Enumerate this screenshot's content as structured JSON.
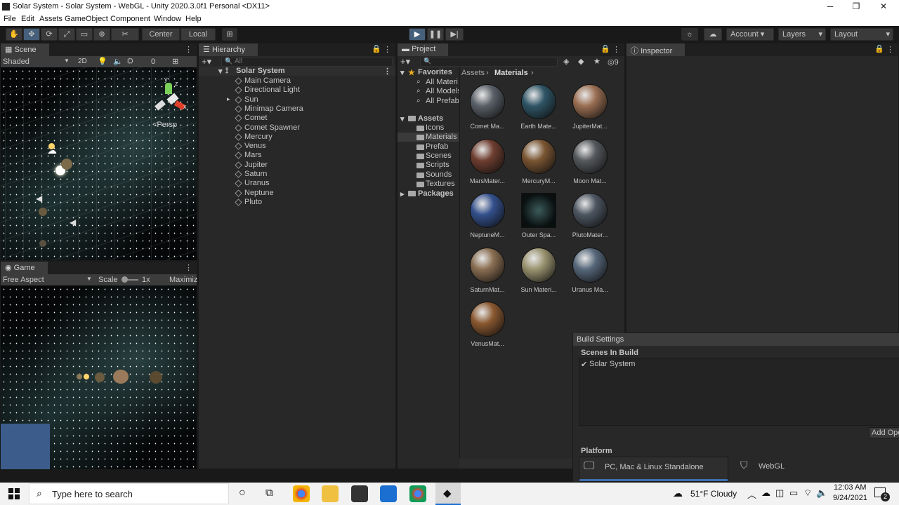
{
  "window": {
    "title": "Solar System - Solar System - WebGL - Unity 2020.3.0f1 Personal <DX11>",
    "minimize": "─",
    "maximize": "❐",
    "close": "✕"
  },
  "menu": [
    "File",
    "Edit",
    "Assets",
    "GameObject",
    "Component",
    "Window",
    "Help"
  ],
  "toolbar": {
    "center_label": "Center",
    "local_label": "Local",
    "account": "Account",
    "layers": "Layers",
    "layout": "Layout",
    "play_icon": "play-icon",
    "pause_icon": "pause-icon",
    "step_icon": "step-icon"
  },
  "scene": {
    "tab": "Scene",
    "shading": "Shaded",
    "mode_2d": "2D",
    "hidden_count": "0",
    "persp": "<Persp",
    "gizmo_y": "y",
    "gizmo_z": "z",
    "gizmo_x": "x"
  },
  "game": {
    "tab": "Game",
    "aspect": "Free Aspect",
    "scale_label": "Scale",
    "scale_value": "1x",
    "maximize": "Maximiz"
  },
  "hierarchy": {
    "tab": "Hierarchy",
    "search_placeholder": "All",
    "root": "Solar System",
    "items": [
      "Main Camera",
      "Directional Light",
      "Sun",
      "Minimap Camera",
      "Comet",
      "Comet Spawner",
      "Mercury",
      "Venus",
      "Mars",
      "Jupiter",
      "Saturn",
      "Uranus",
      "Neptune",
      "Pluto"
    ]
  },
  "project": {
    "tab": "Project",
    "hidden_count": "9",
    "favorites_label": "Favorites",
    "favorites": [
      "All Materi",
      "All Models",
      "All Prefab"
    ],
    "assets_label": "Assets",
    "folders": [
      "Icons",
      "Materials",
      "Prefab",
      "Scenes",
      "Scripts",
      "Sounds",
      "Textures"
    ],
    "packages_label": "Packages",
    "breadcrumb_root": "Assets",
    "breadcrumb_current": "Materials",
    "materials": [
      {
        "name": "Comet Ma...",
        "color": "#5a6068"
      },
      {
        "name": "Earth Mate...",
        "color": "#2f5566"
      },
      {
        "name": "JupiterMat...",
        "color": "#9a6e52"
      },
      {
        "name": "MarsMater...",
        "color": "#6e3e30"
      },
      {
        "name": "MercuryM...",
        "color": "#7a5532"
      },
      {
        "name": "Moon Mat...",
        "color": "#55585c"
      },
      {
        "name": "NeptuneM...",
        "color": "#34508c"
      },
      {
        "name": "Outer Spa...",
        "color": "#1c2a2a"
      },
      {
        "name": "PlutoMater...",
        "color": "#4c5560"
      },
      {
        "name": "SaturnMat...",
        "color": "#8a6e52"
      },
      {
        "name": "Sun Materi...",
        "color": "#9a9370"
      },
      {
        "name": "Uranus Ma...",
        "color": "#56677a"
      },
      {
        "name": "VenusMat...",
        "color": "#8a5830"
      }
    ]
  },
  "inspector": {
    "tab": "Inspector"
  },
  "build": {
    "title": "Build Settings",
    "scenes_label": "Scenes In Build",
    "scene": "Solar System",
    "add_open": "Add Ope",
    "platform_label": "Platform",
    "platforms": [
      "PC, Mac & Linux Standalone",
      "WebGL"
    ]
  },
  "taskbar": {
    "search_placeholder": "Type here to search",
    "weather": "51°F  Cloudy",
    "time": "12:03 AM",
    "date": "9/24/2021",
    "notifications": "2"
  }
}
